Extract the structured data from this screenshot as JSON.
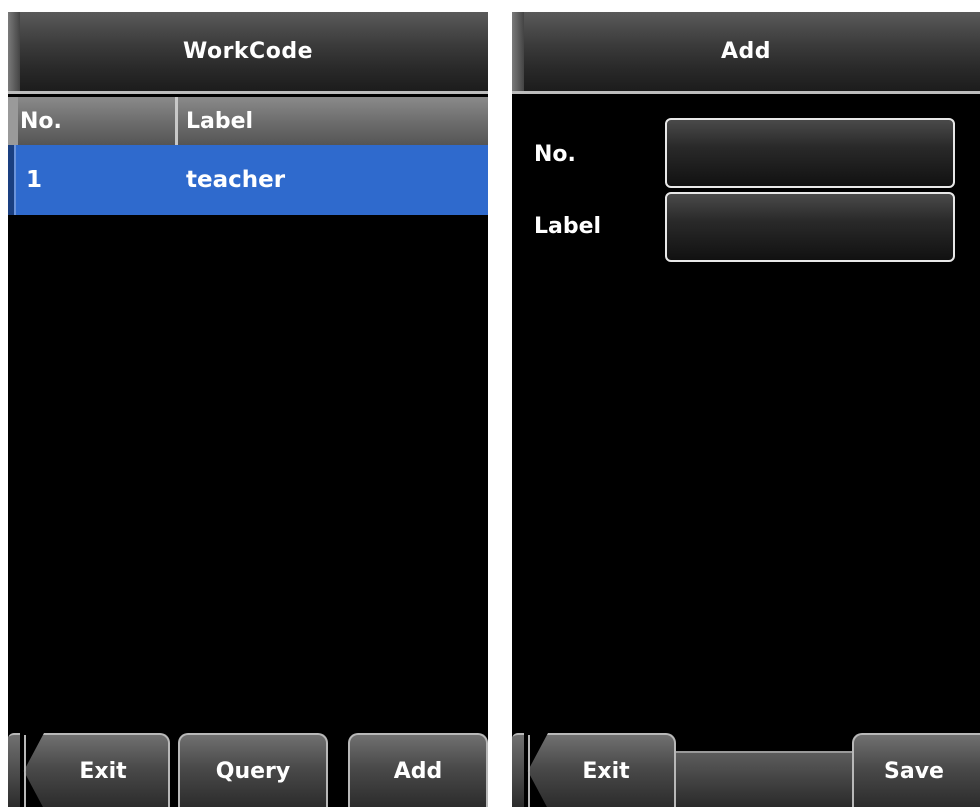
{
  "workcode_panel": {
    "title": "WorkCode",
    "columns": [
      "No.",
      "Label"
    ],
    "rows": [
      {
        "no": "1",
        "label": "teacher"
      }
    ],
    "buttons": {
      "exit": "Exit",
      "query": "Query",
      "add": "Add"
    }
  },
  "add_panel": {
    "title": "Add",
    "fields": {
      "no_label": "No.",
      "no_value": "",
      "label_label": "Label",
      "label_value": ""
    },
    "buttons": {
      "exit": "Exit",
      "save": "Save"
    }
  },
  "colors": {
    "selected_row": "#2f6acd",
    "background": "#000000"
  }
}
